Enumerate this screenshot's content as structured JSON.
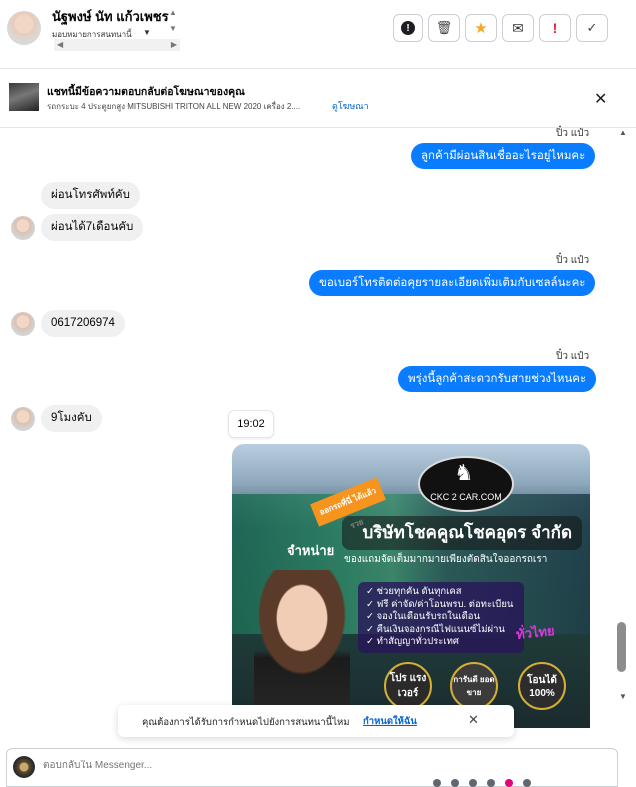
{
  "header": {
    "contact_name": "นัฐพงษ์ นัท แก้วเพชร",
    "assign_label": "มอบหมายการสนทนานี้",
    "actions": [
      {
        "name": "info-icon",
        "glyph": "!"
      },
      {
        "name": "trash-icon",
        "glyph": "🗑"
      },
      {
        "name": "star-icon",
        "glyph": "★"
      },
      {
        "name": "mark-unread-icon",
        "glyph": "✉"
      },
      {
        "name": "spam-icon",
        "glyph": "!"
      },
      {
        "name": "done-icon",
        "glyph": "✓"
      }
    ]
  },
  "ad_banner": {
    "title": "แชทนี้มีข้อความตอบกลับต่อโฆษณาของคุณ",
    "subtitle": "รถกระบะ 4 ประตูยกสูง MITSUBISHI TRITON ALL NEW 2020 เครื่อง 2....",
    "link": "ดูโฆษณา",
    "close_icon": "✕"
  },
  "messages": {
    "m1": {
      "sender": "ปิ๋ว แป๋ว",
      "text": "ลูกค้ามีผ่อนสินเชื่ออะไรอยู่ไหมคะ"
    },
    "m2": {
      "text": "ผ่อนโทรศัพท์คับ"
    },
    "m3": {
      "text": "ผ่อนได้7เดือนคับ"
    },
    "m4": {
      "sender": "ปิ๋ว แป๋ว",
      "text": "ขอเบอร์โทรติดต่อคุยรายละเอียดเพิ่มเติมกับเซลล์นะคะ"
    },
    "m5": {
      "text": "0617206974"
    },
    "m6": {
      "sender": "ปิ๋ว แป๋ว",
      "text": "พรุ่งนี้ลูกค้าสะดวกรับสายช่วงไหนคะ"
    },
    "m7": {
      "text": "9โมงคับ"
    },
    "timestamp": "19:02"
  },
  "image_attachment": {
    "logo_text": "CKC 2 CAR.COM",
    "company": "บริษัทโชคคูณโชคอุดร จำกัด",
    "tagline": "ของแถมจัดเต็มมากมายเพียงตัดสินใจออกรถเรา",
    "ribbon": "ออกรถที่นี่ ได้แล้วรวย",
    "sale_word": "จำหน่าย",
    "bullets": [
      "ช่วยทุกคัน ดันทุกเคส",
      "ฟรี ค่าจัด/ค่าโอนพรบ. ต่อทะเบียน",
      "จองในเดือนรับรถในเดือน",
      "คืนเงินจองกรณีไฟแนนซ์ไม่ผ่าน",
      "ทำสัญญาทั่วประเทศ"
    ],
    "tag": "ทั่วไทย",
    "badges": [
      "โปร แรง เวอร์",
      "การันตี ยอดขาย",
      "โอนได้ 100%"
    ]
  },
  "toast": {
    "text": "คุณต้องการได้รับการกำหนดไปยังการสนทนานี้ไหม",
    "link": "กำหนดให้ฉัน",
    "close_icon": "✕"
  },
  "composer": {
    "placeholder": "ตอบกลับใน Messenger..."
  },
  "colors": {
    "outgoing_bubble": "#0a7cff",
    "incoming_bubble": "#f0f0f0",
    "link": "#0064d1",
    "star": "#f5a623",
    "spam": "#e41e3f"
  }
}
